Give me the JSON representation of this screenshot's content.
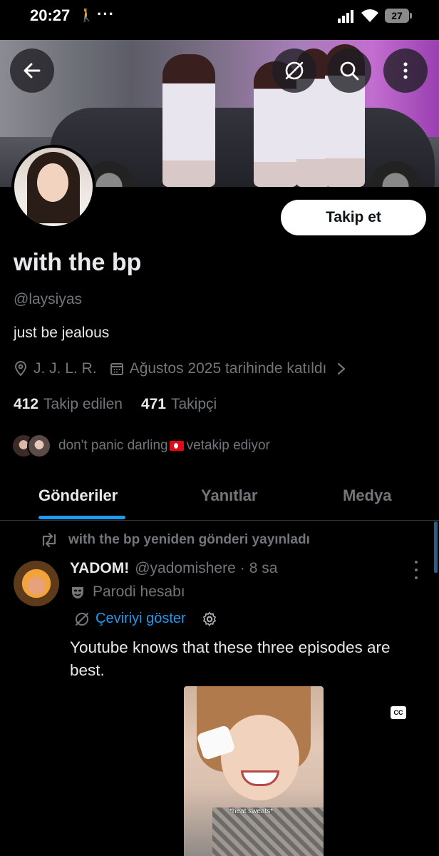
{
  "status_bar": {
    "time": "20:27",
    "dots": "···",
    "battery": "27"
  },
  "header": {
    "back_icon": "arrow-left-icon",
    "icons": [
      "translate-off-icon",
      "search-icon",
      "more-vertical-icon"
    ]
  },
  "profile": {
    "display_name": "with the bp",
    "handle": "@laysiyas",
    "bio": "just be jealous",
    "location": "J. J. L. R.",
    "joined": "Ağustos 2025 tarihinde katıldı",
    "following_count": "412",
    "following_label": "Takip edilen",
    "followers_count": "471",
    "followers_label": "Takipçi",
    "follow_button": "Takip et",
    "followed_by_text_before": "don't panic darling",
    "followed_by_text_after": " ve ",
    "followed_by_suffix": "takip ediyor"
  },
  "tabs": [
    {
      "label": "Gönderiler",
      "active": true
    },
    {
      "label": "Yanıtlar",
      "active": false
    },
    {
      "label": "Medya",
      "active": false
    }
  ],
  "post": {
    "repost_text": "with the bp yeniden gönderi yayınladı",
    "author_name": "YADOM!",
    "author_handle": "@yadomishere",
    "separator": "·",
    "time": "8 sa",
    "parody_label": "Parodi hesabı",
    "translate_label": "Çeviriyi göster",
    "text": "Youtube knows that these three episodes are best.",
    "media_caption": "*heat sweats*",
    "cc_label": "CC"
  },
  "colors": {
    "accent": "#1d9bf0",
    "secondary_text": "#71767b",
    "primary_text": "#e7e9ea",
    "background": "#000000"
  }
}
